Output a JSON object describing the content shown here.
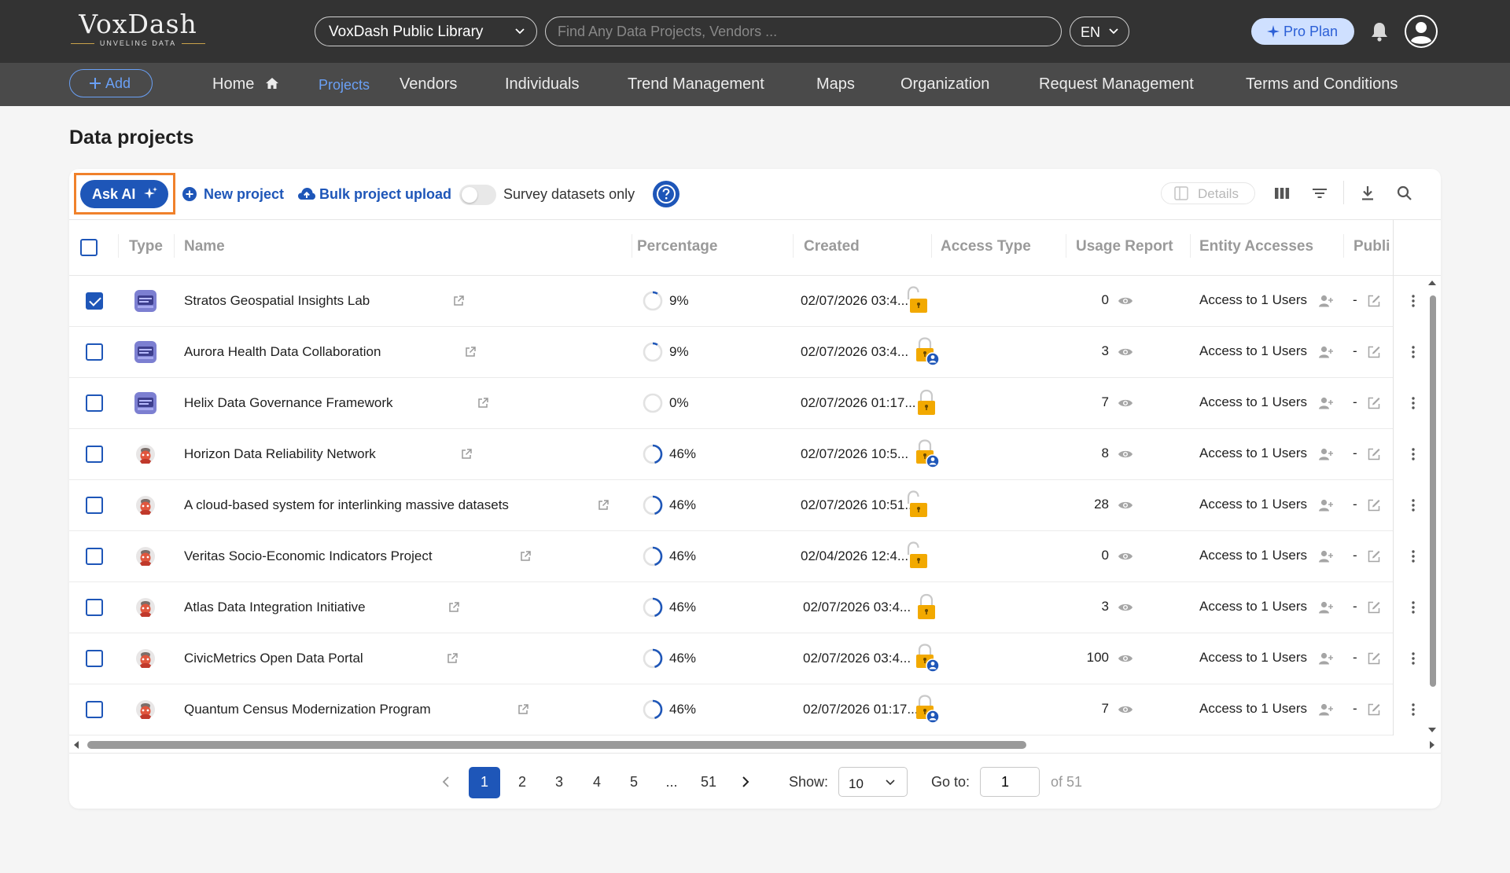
{
  "header": {
    "logo": "VoxDash",
    "logo_tag": "UNVELING DATA",
    "library": "VoxDash Public Library",
    "search_placeholder": "Find Any Data Projects, Vendors ...",
    "language": "EN",
    "plan": "Pro Plan"
  },
  "nav": {
    "add_label": "Add",
    "items": [
      "Home",
      "Projects",
      "Vendors",
      "Individuals",
      "Trend Management",
      "Maps",
      "Organization",
      "Request Management",
      "Terms and Conditions"
    ],
    "active": "Projects"
  },
  "page": {
    "title": "Data projects"
  },
  "toolbar": {
    "ask_ai": "Ask AI",
    "new_project": "New project",
    "bulk_upload": "Bulk project upload",
    "survey_toggle_label": "Survey datasets only",
    "survey_toggle_on": false,
    "details": "Details"
  },
  "table": {
    "columns": [
      "Type",
      "Name",
      "Percentage",
      "Created",
      "Access Type",
      "Usage Report",
      "Entity Accesses",
      "Publi"
    ],
    "rows": [
      {
        "checked": true,
        "type": "dataset",
        "name": "Stratos Geospatial Insights Lab",
        "percent": "9%",
        "percent_value": 9,
        "created": "02/07/2026 03:4...",
        "access": "open-lock",
        "usage": "0",
        "entity": "Access to 1 Users",
        "publish": "-"
      },
      {
        "checked": false,
        "type": "dataset",
        "name": "Aurora Health Data Collaboration",
        "percent": "9%",
        "percent_value": 9,
        "created": "02/07/2026 03:4...",
        "access": "lock-user",
        "usage": "3",
        "entity": "Access to 1 Users",
        "publish": "-"
      },
      {
        "checked": false,
        "type": "dataset",
        "name": "Helix Data Governance Framework",
        "percent": "0%",
        "percent_value": 0,
        "created": "02/07/2026 01:17...",
        "access": "lock",
        "usage": "7",
        "entity": "Access to 1 Users",
        "publish": "-"
      },
      {
        "checked": false,
        "type": "survey",
        "name": "Horizon Data Reliability Network",
        "percent": "46%",
        "percent_value": 46,
        "created": "02/07/2026 10:5...",
        "access": "lock-user",
        "usage": "8",
        "entity": "Access to 1 Users",
        "publish": "-"
      },
      {
        "checked": false,
        "type": "survey",
        "name": "A cloud-based system for interlinking massive datasets",
        "percent": "46%",
        "percent_value": 46,
        "created": "02/07/2026 10:51...",
        "access": "open-lock",
        "usage": "28",
        "entity": "Access to 1 Users",
        "publish": "-"
      },
      {
        "checked": false,
        "type": "survey",
        "name": "Veritas Socio-Economic Indicators Project",
        "percent": "46%",
        "percent_value": 46,
        "created": "02/04/2026 12:4...",
        "access": "open-lock",
        "usage": "0",
        "entity": "Access to 1 Users",
        "publish": "-"
      },
      {
        "checked": false,
        "type": "survey",
        "name": "Atlas Data Integration Initiative",
        "percent": "46%",
        "percent_value": 46,
        "created": "02/07/2026 03:4...",
        "access": "lock",
        "usage": "3",
        "entity": "Access to 1 Users",
        "publish": "-"
      },
      {
        "checked": false,
        "type": "survey",
        "name": "CivicMetrics Open Data Portal",
        "percent": "46%",
        "percent_value": 46,
        "created": "02/07/2026 03:4...",
        "access": "lock-user",
        "usage": "100",
        "entity": "Access to 1 Users",
        "publish": "-"
      },
      {
        "checked": false,
        "type": "survey",
        "name": "Quantum Census Modernization Program",
        "percent": "46%",
        "percent_value": 46,
        "created": "02/07/2026 01:17...",
        "access": "lock-user",
        "usage": "7",
        "entity": "Access to 1 Users",
        "publish": "-"
      }
    ]
  },
  "pagination": {
    "pages": [
      "1",
      "2",
      "3",
      "4",
      "5",
      "...",
      "51"
    ],
    "current": "1",
    "show_label": "Show:",
    "show_value": "10",
    "goto_label": "Go to:",
    "goto_value": "1",
    "of_label": "of 51"
  },
  "colors": {
    "brand": "#1e56b8",
    "topbar": "#333333",
    "navbar": "#4a4a4a",
    "lock": "#f2a900",
    "highlight": "#f0812b"
  }
}
